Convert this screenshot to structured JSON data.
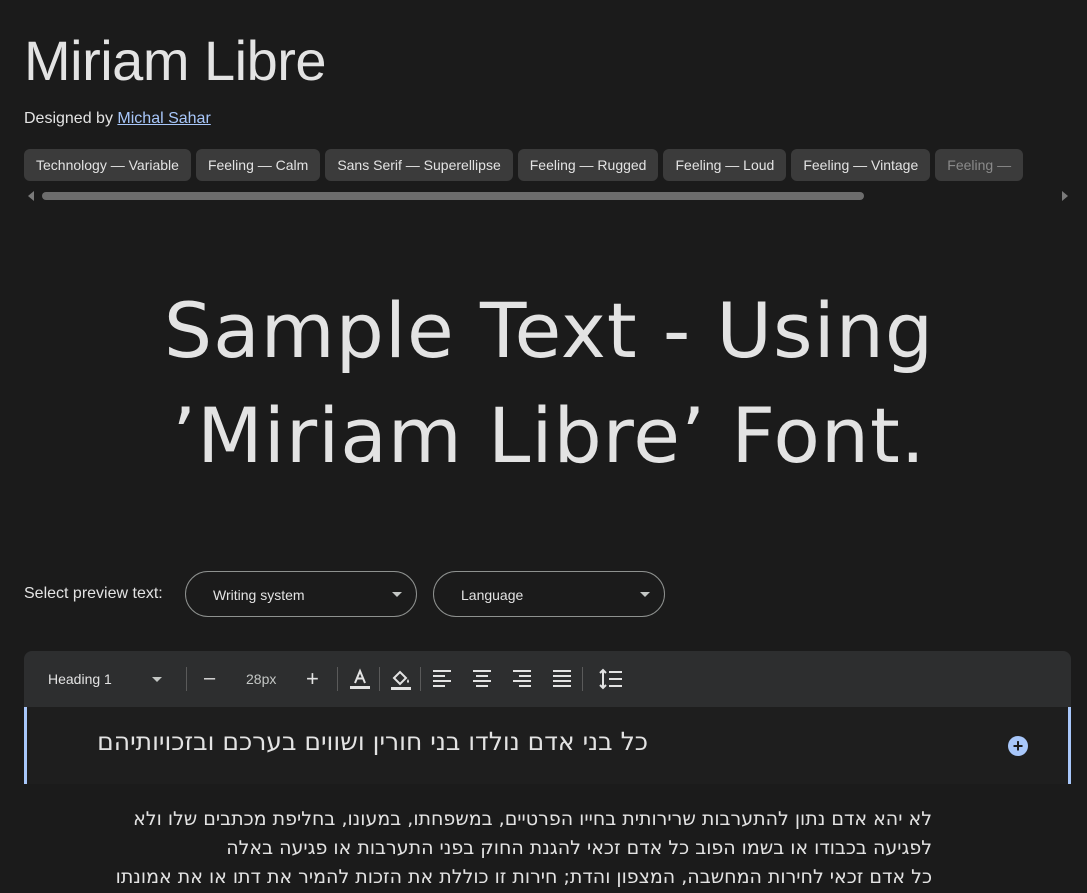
{
  "font": {
    "title": "Miriam Libre",
    "designed_by_label": "Designed by",
    "designer": "Michal Sahar"
  },
  "tags": [
    "Technology — Variable",
    "Feeling — Calm",
    "Sans Serif — Superellipse",
    "Feeling — Rugged",
    "Feeling — Loud",
    "Feeling — Vintage",
    "Feeling — "
  ],
  "sample": {
    "line1": "Sample Text - Using",
    "line2": "’Miriam Libre’ Font."
  },
  "preview": {
    "label": "Select preview text:",
    "writing_system": "Writing system",
    "language": "Language"
  },
  "toolbar": {
    "style": "Heading 1",
    "decrease": "–",
    "size": "28px",
    "increase": "+"
  },
  "editor": {
    "heading": "כל בני אדם נולדו בני חורין ושווים בערכם ובזכויותיהם",
    "body": [
      "לא יהא אדם נתון להתערבות שרירותית בחייו הפרטיים, במשפחתו, במעונו, בחליפת מכתבים שלו ולא",
      "לפגיעה בכבודו או בשמו הפוב כל אדם זכאי להגנת החוק בפני התערבות או פגיעה באלה",
      "כל אדם זכאי לחירות המחשבה, המצפון והדת; חירות זו כוללת את הזכות להמיר את דתו או את אמונתו"
    ]
  },
  "colors": {
    "background": "#1b1b1b",
    "tag_bg": "#3b3b3b",
    "accent": "#a8c7fa",
    "toolbar_bg": "#2d2e2f"
  }
}
